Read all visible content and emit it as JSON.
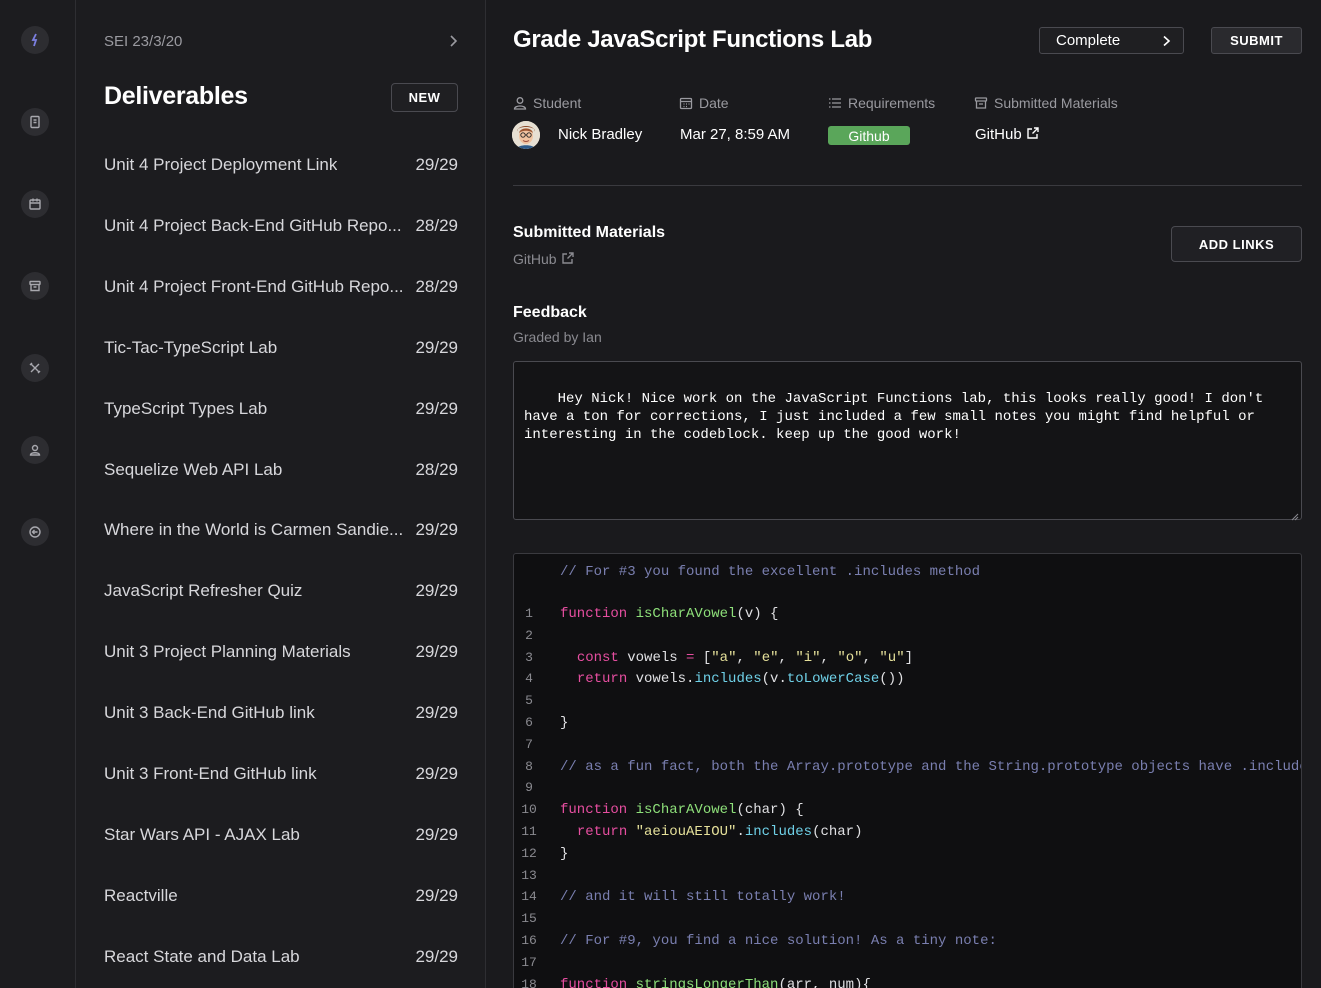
{
  "rail": {
    "icons": [
      "logo-icon",
      "notebook-icon",
      "calendar-icon",
      "archive-icon",
      "tools-icon",
      "profile-icon",
      "logout-icon"
    ]
  },
  "sidebar": {
    "cohort": "SEI 23/3/20",
    "title": "Deliverables",
    "new_label": "NEW",
    "items": [
      {
        "name": "Unit 4 Project Deployment Link",
        "count": "29/29"
      },
      {
        "name": "Unit 4 Project Back-End GitHub Repo...",
        "count": "28/29"
      },
      {
        "name": "Unit 4 Project Front-End GitHub Repo...",
        "count": "28/29"
      },
      {
        "name": "Tic-Tac-TypeScript Lab",
        "count": "29/29"
      },
      {
        "name": "TypeScript Types Lab",
        "count": "29/29"
      },
      {
        "name": "Sequelize Web API Lab",
        "count": "28/29"
      },
      {
        "name": "Where in the World is Carmen Sandie...",
        "count": "29/29"
      },
      {
        "name": "JavaScript Refresher Quiz",
        "count": "29/29"
      },
      {
        "name": "Unit 3 Project Planning Materials",
        "count": "29/29"
      },
      {
        "name": "Unit 3 Back-End GitHub link",
        "count": "29/29"
      },
      {
        "name": "Unit 3 Front-End GitHub link",
        "count": "29/29"
      },
      {
        "name": "Star Wars API - AJAX Lab",
        "count": "29/29"
      },
      {
        "name": "Reactville",
        "count": "29/29"
      },
      {
        "name": "React State and Data Lab",
        "count": "29/29"
      }
    ]
  },
  "header": {
    "title": "Grade JavaScript Functions Lab",
    "status": "Complete",
    "submit_label": "SUBMIT"
  },
  "meta": {
    "student_label": "Student",
    "student_name": "Nick Bradley",
    "date_label": "Date",
    "date_value": "Mar 27, 8:59 AM",
    "requirements_label": "Requirements",
    "requirement_badge": "Github",
    "materials_label": "Submitted Materials",
    "materials_value": "GitHub"
  },
  "submitted": {
    "title": "Submitted Materials",
    "link": "GitHub",
    "add_links_label": "ADD LINKS"
  },
  "feedback": {
    "title": "Feedback",
    "graded_by": "Graded by Ian",
    "text": "Hey Nick! Nice work on the JavaScript Functions lab, this looks really good! I don't have a ton for corrections, I just included a few small notes you might find helpful or interesting in the codeblock. keep up the good work!"
  },
  "code": {
    "header_comment": "// For #3 you found the excellent .includes method",
    "line_numbers": [
      "1",
      "2",
      "3",
      "4",
      "5",
      "6",
      "7",
      "8",
      "9",
      "10",
      "11",
      "12",
      "13",
      "14",
      "15",
      "16",
      "17",
      "18"
    ],
    "lines": [
      [
        [
          "kw",
          "function "
        ],
        [
          "fn",
          "isCharAVowel"
        ],
        [
          "plain",
          "(v) {"
        ]
      ],
      [],
      [
        [
          "plain",
          "  "
        ],
        [
          "kw",
          "const "
        ],
        [
          "plain",
          "vowels "
        ],
        [
          "kw",
          "= "
        ],
        [
          "plain",
          "["
        ],
        [
          "str",
          "\"a\""
        ],
        [
          "plain",
          ", "
        ],
        [
          "str",
          "\"e\""
        ],
        [
          "plain",
          ", "
        ],
        [
          "str",
          "\"i\""
        ],
        [
          "plain",
          ", "
        ],
        [
          "str",
          "\"o\""
        ],
        [
          "plain",
          ", "
        ],
        [
          "str",
          "\"u\""
        ],
        [
          "plain",
          "]"
        ]
      ],
      [
        [
          "plain",
          "  "
        ],
        [
          "kw",
          "return "
        ],
        [
          "plain",
          "vowels."
        ],
        [
          "prop",
          "includes"
        ],
        [
          "plain",
          "(v."
        ],
        [
          "prop",
          "toLowerCase"
        ],
        [
          "plain",
          "())"
        ]
      ],
      [],
      [
        [
          "plain",
          "}"
        ]
      ],
      [],
      [
        [
          "comment",
          "// as a fun fact, both the Array.prototype and the String.prototype objects have .includes"
        ]
      ],
      [],
      [
        [
          "kw",
          "function "
        ],
        [
          "fn",
          "isCharAVowel"
        ],
        [
          "plain",
          "(char) {"
        ]
      ],
      [
        [
          "plain",
          "  "
        ],
        [
          "kw",
          "return "
        ],
        [
          "str",
          "\"aeiouAEIOU\""
        ],
        [
          "plain",
          "."
        ],
        [
          "prop",
          "includes"
        ],
        [
          "plain",
          "(char)"
        ]
      ],
      [
        [
          "plain",
          "}"
        ]
      ],
      [],
      [
        [
          "comment",
          "// and it will still totally work!"
        ]
      ],
      [],
      [
        [
          "comment",
          "// For #9, you find a nice solution! As a tiny note:"
        ]
      ],
      [],
      [
        [
          "kw",
          "function "
        ],
        [
          "fn",
          "stringsLongerThan"
        ],
        [
          "plain",
          "(arr, num){"
        ]
      ]
    ]
  }
}
